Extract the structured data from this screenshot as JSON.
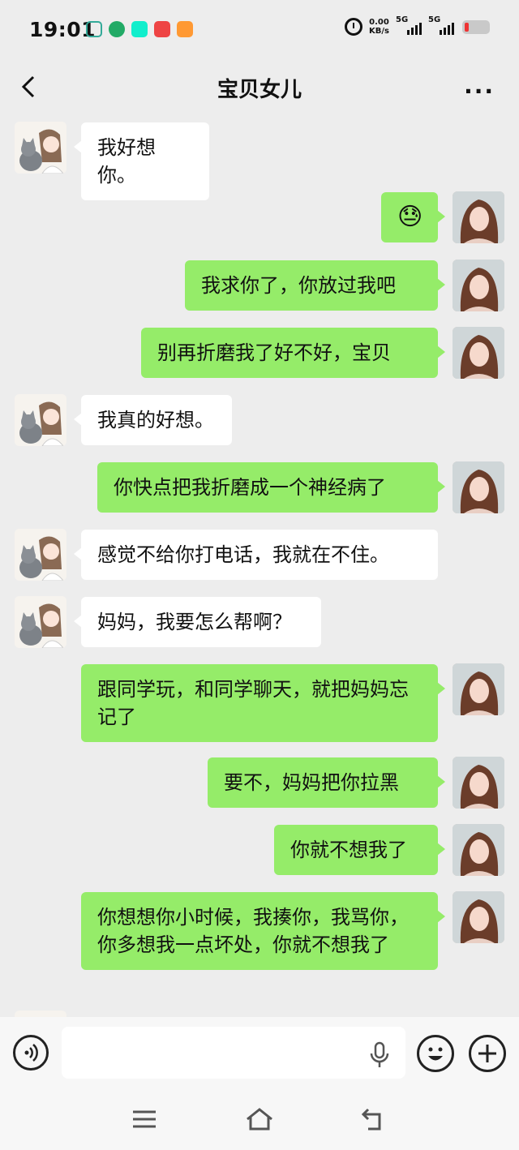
{
  "status_bar": {
    "time": "19:01",
    "net_speed": "0.00",
    "net_unit": "KB/s",
    "sim1": "5G",
    "sim2": "5G"
  },
  "header": {
    "title": "宝贝女儿",
    "more": "···"
  },
  "messages": [
    {
      "side": "left",
      "text": "我好想你。"
    },
    {
      "side": "right",
      "text": "😓"
    },
    {
      "side": "right",
      "text": "我求你了，你放过我吧"
    },
    {
      "side": "right",
      "text": "别再折磨我了好不好，宝贝"
    },
    {
      "side": "left",
      "text": "我真的好想。"
    },
    {
      "side": "right",
      "text": "你快点把我折磨成一个神经病了"
    },
    {
      "side": "left",
      "text": "感觉不给你打电话，我就在不住。"
    },
    {
      "side": "left",
      "text": "妈妈，我要怎么帮啊？"
    },
    {
      "side": "right",
      "text": "跟同学玩，和同学聊天，就把妈妈忘记了"
    },
    {
      "side": "right",
      "text": "要不，妈妈把你拉黑"
    },
    {
      "side": "right",
      "text": "你就不想我了"
    },
    {
      "side": "right",
      "text": "你想想你小时候，我揍你，我骂你，你多想我一点坏处，你就不想我了"
    }
  ],
  "colors": {
    "self_bubble": "#95ec69",
    "other_bubble": "#ffffff",
    "background": "#ededed"
  }
}
